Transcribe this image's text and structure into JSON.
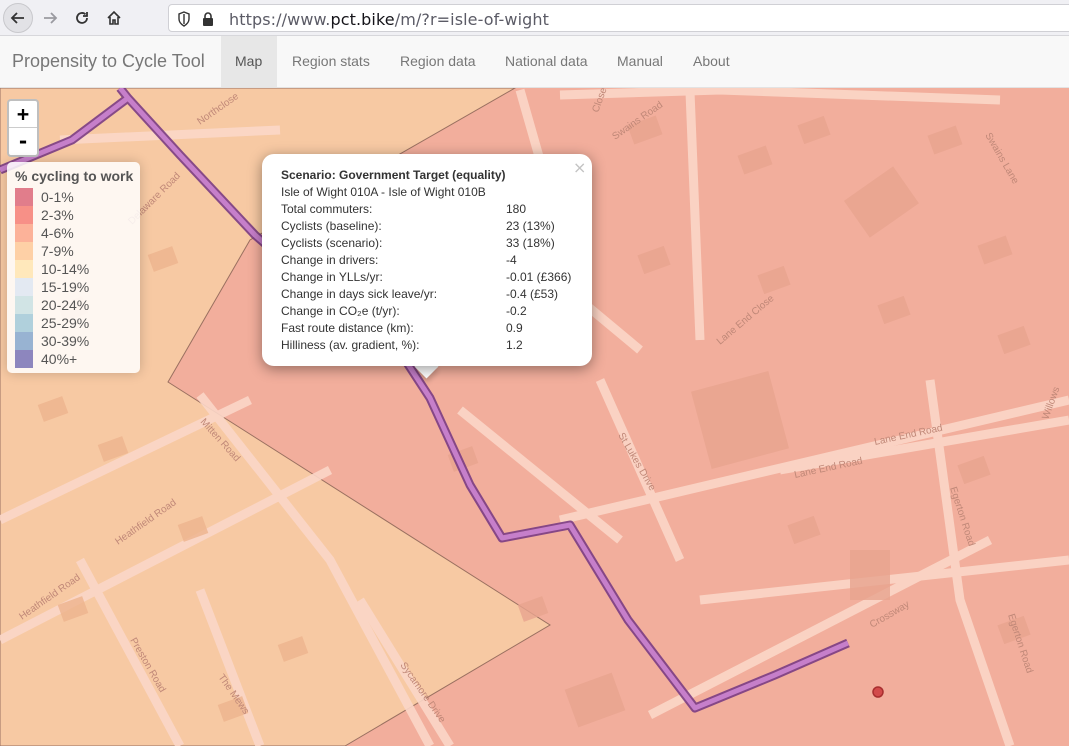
{
  "browser": {
    "url_prefix": "https://www.",
    "url_host": "pct.bike",
    "url_path": "/m/?r=isle-of-wight"
  },
  "app": {
    "brand": "Propensity to Cycle Tool",
    "tabs": [
      {
        "label": "Map",
        "active": true
      },
      {
        "label": "Region stats",
        "active": false
      },
      {
        "label": "Region data",
        "active": false
      },
      {
        "label": "National data",
        "active": false
      },
      {
        "label": "Manual",
        "active": false
      },
      {
        "label": "About",
        "active": false
      }
    ]
  },
  "zoom": {
    "in": "+",
    "out": "-"
  },
  "legend": {
    "title": "% cycling to work",
    "items": [
      {
        "label": "0-1%",
        "color": "#d4495f"
      },
      {
        "label": "2-3%",
        "color": "#f4645a"
      },
      {
        "label": "4-6%",
        "color": "#fb9473"
      },
      {
        "label": "7-9%",
        "color": "#fdbf86"
      },
      {
        "label": "10-14%",
        "color": "#ffe1a4"
      },
      {
        "label": "15-19%",
        "color": "#d7e3f2"
      },
      {
        "label": "20-24%",
        "color": "#bddbe0"
      },
      {
        "label": "25-29%",
        "color": "#8ebfd3"
      },
      {
        "label": "30-39%",
        "color": "#6c96c5"
      },
      {
        "label": "40%+",
        "color": "#5c55a8"
      }
    ]
  },
  "popup": {
    "title": "Scenario: Government Target (equality)",
    "subtitle": "Isle of Wight 010A - Isle of Wight 010B",
    "close": "×",
    "rows": [
      {
        "key": "Total commuters:",
        "value": "180"
      },
      {
        "key": "Cyclists (baseline):",
        "value": "23 (13%)"
      },
      {
        "key": "Cyclists (scenario):",
        "value": "33 (18%)"
      },
      {
        "key": "Change in drivers:",
        "value": "-4"
      },
      {
        "key": "Change in YLLs/yr:",
        "value": "-0.01 (£366)"
      },
      {
        "key": "Change in days sick leave/yr:",
        "value": "-0.4 (£53)"
      },
      {
        "key": "Change in CO₂e (t/yr):",
        "value": "-0.2"
      },
      {
        "key": "Fast route distance (km):",
        "value": "0.9"
      },
      {
        "key": "Hilliness (av. gradient, %):",
        "value": "1.2"
      }
    ]
  },
  "map": {
    "colors": {
      "zone_a": "#f7caa5",
      "zone_b": "#f2ad9b",
      "route": "#b060b0",
      "route_edge": "#7a3c84"
    },
    "street_labels": [
      "Northclose",
      "Delaware Road",
      "Swains Road",
      "Swains Lane",
      "Lane End Close",
      "Lane End Road",
      "Lane End Road",
      "St Lukes Drive",
      "Egerton Road",
      "Egerton Road",
      "Willows",
      "Mitten Road",
      "Heathfield Road",
      "Heathfield Road",
      "Preston Road",
      "The Mews",
      "Sycamore Drive",
      "Crossway",
      "Close"
    ]
  }
}
